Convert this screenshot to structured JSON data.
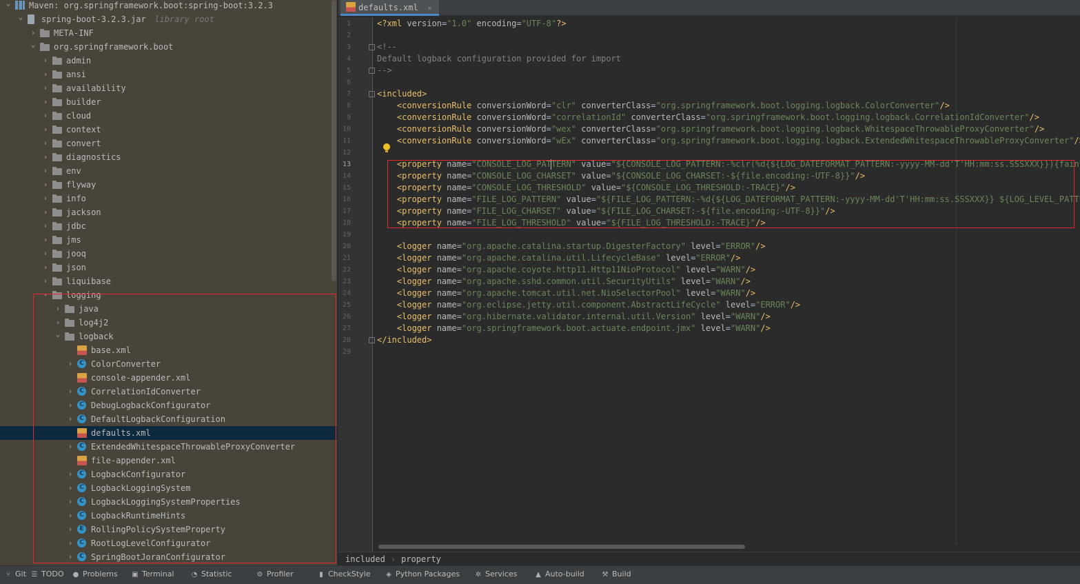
{
  "tree": {
    "items": [
      {
        "label": "Maven: org.springframework.boot:spring-boot:3.2.3",
        "icon": "maven-library-icon",
        "depth": 0,
        "chevron": "down"
      },
      {
        "label": "spring-boot-3.2.3.jar",
        "note": "library root",
        "icon": "jar-icon",
        "depth": 1,
        "chevron": "down"
      },
      {
        "label": "META-INF",
        "icon": "folder-icon",
        "depth": 2,
        "chevron": "right"
      },
      {
        "label": "org.springframework.boot",
        "icon": "folder-icon",
        "depth": 2,
        "chevron": "down"
      },
      {
        "label": "admin",
        "icon": "folder-icon",
        "depth": 3,
        "chevron": "right"
      },
      {
        "label": "ansi",
        "icon": "folder-icon",
        "depth": 3,
        "chevron": "right"
      },
      {
        "label": "availability",
        "icon": "folder-icon",
        "depth": 3,
        "chevron": "right"
      },
      {
        "label": "builder",
        "icon": "folder-icon",
        "depth": 3,
        "chevron": "right"
      },
      {
        "label": "cloud",
        "icon": "folder-icon",
        "depth": 3,
        "chevron": "right"
      },
      {
        "label": "context",
        "icon": "folder-icon",
        "depth": 3,
        "chevron": "right"
      },
      {
        "label": "convert",
        "icon": "folder-icon",
        "depth": 3,
        "chevron": "right"
      },
      {
        "label": "diagnostics",
        "icon": "folder-icon",
        "depth": 3,
        "chevron": "right"
      },
      {
        "label": "env",
        "icon": "folder-icon",
        "depth": 3,
        "chevron": "right"
      },
      {
        "label": "flyway",
        "icon": "folder-icon",
        "depth": 3,
        "chevron": "right"
      },
      {
        "label": "info",
        "icon": "folder-icon",
        "depth": 3,
        "chevron": "right"
      },
      {
        "label": "jackson",
        "icon": "folder-icon",
        "depth": 3,
        "chevron": "right"
      },
      {
        "label": "jdbc",
        "icon": "folder-icon",
        "depth": 3,
        "chevron": "right"
      },
      {
        "label": "jms",
        "icon": "folder-icon",
        "depth": 3,
        "chevron": "right"
      },
      {
        "label": "jooq",
        "icon": "folder-icon",
        "depth": 3,
        "chevron": "right"
      },
      {
        "label": "json",
        "icon": "folder-icon",
        "depth": 3,
        "chevron": "right"
      },
      {
        "label": "liquibase",
        "icon": "folder-icon",
        "depth": 3,
        "chevron": "right"
      },
      {
        "label": "logging",
        "icon": "folder-icon",
        "depth": 3,
        "chevron": "down"
      },
      {
        "label": "java",
        "icon": "folder-icon",
        "depth": 4,
        "chevron": "right"
      },
      {
        "label": "log4j2",
        "icon": "folder-icon",
        "depth": 4,
        "chevron": "right"
      },
      {
        "label": "logback",
        "icon": "folder-icon",
        "depth": 4,
        "chevron": "down"
      },
      {
        "label": "base.xml",
        "icon": "xml-file-icon",
        "depth": 5,
        "chevron": ""
      },
      {
        "label": "ColorConverter",
        "icon": "class-icon",
        "depth": 5,
        "chevron": "right"
      },
      {
        "label": "console-appender.xml",
        "icon": "xml-file-icon",
        "depth": 5,
        "chevron": ""
      },
      {
        "label": "CorrelationIdConverter",
        "icon": "class-icon",
        "depth": 5,
        "chevron": "right"
      },
      {
        "label": "DebugLogbackConfigurator",
        "icon": "class-icon",
        "depth": 5,
        "chevron": "right"
      },
      {
        "label": "DefaultLogbackConfiguration",
        "icon": "class-icon",
        "depth": 5,
        "chevron": "right"
      },
      {
        "label": "defaults.xml",
        "icon": "xml-file-icon",
        "depth": 5,
        "chevron": "",
        "selected": true
      },
      {
        "label": "ExtendedWhitespaceThrowableProxyConverter",
        "icon": "class-icon",
        "depth": 5,
        "chevron": "right"
      },
      {
        "label": "file-appender.xml",
        "icon": "xml-file-icon",
        "depth": 5,
        "chevron": ""
      },
      {
        "label": "LogbackConfigurator",
        "icon": "class-icon",
        "depth": 5,
        "chevron": "right"
      },
      {
        "label": "LogbackLoggingSystem",
        "icon": "class-icon",
        "depth": 5,
        "chevron": "right"
      },
      {
        "label": "LogbackLoggingSystemProperties",
        "icon": "class-icon",
        "depth": 5,
        "chevron": "right"
      },
      {
        "label": "LogbackRuntimeHints",
        "icon": "class-icon",
        "depth": 5,
        "chevron": "right"
      },
      {
        "label": "RollingPolicySystemProperty",
        "icon": "enum-icon",
        "depth": 5,
        "chevron": "right"
      },
      {
        "label": "RootLogLevelConfigurator",
        "icon": "class-icon",
        "depth": 5,
        "chevron": "right"
      },
      {
        "label": "SpringBootJoranConfigurator",
        "icon": "class-icon",
        "depth": 5,
        "chevron": "right"
      }
    ]
  },
  "editor": {
    "tab": {
      "label": "defaults.xml",
      "close": "×"
    },
    "current_line": 13,
    "lines": [
      [
        [
          "pi",
          "<?xml "
        ],
        [
          "attr",
          "version"
        ],
        [
          "",
          "="
        ],
        [
          "val",
          "\"1.0\""
        ],
        [
          "",
          " "
        ],
        [
          "attr",
          "encoding"
        ],
        [
          "",
          "="
        ],
        [
          "val",
          "\"UTF-8\""
        ],
        [
          "pi",
          "?>"
        ]
      ],
      [],
      [
        [
          "cmt",
          "<!--"
        ]
      ],
      [
        [
          "cmt",
          "Default logback configuration provided for import"
        ]
      ],
      [
        [
          "cmt",
          "-->"
        ]
      ],
      [],
      [
        [
          "tag",
          "<included>"
        ]
      ],
      [
        [
          "",
          "    "
        ],
        [
          "tag",
          "<conversionRule "
        ],
        [
          "attr",
          "conversionWord"
        ],
        [
          "",
          "="
        ],
        [
          "val",
          "\"clr\""
        ],
        [
          "",
          " "
        ],
        [
          "attr",
          "converterClass"
        ],
        [
          "",
          "="
        ],
        [
          "val",
          "\"org.springframework.boot.logging.logback.ColorConverter\""
        ],
        [
          "tag",
          "/>"
        ]
      ],
      [
        [
          "",
          "    "
        ],
        [
          "tag",
          "<conversionRule "
        ],
        [
          "attr",
          "conversionWord"
        ],
        [
          "",
          "="
        ],
        [
          "val",
          "\"correlationId\""
        ],
        [
          "",
          " "
        ],
        [
          "attr",
          "converterClass"
        ],
        [
          "",
          "="
        ],
        [
          "val",
          "\"org.springframework.boot.logging.logback.CorrelationIdConverter\""
        ],
        [
          "tag",
          "/>"
        ]
      ],
      [
        [
          "",
          "    "
        ],
        [
          "tag",
          "<conversionRule "
        ],
        [
          "attr",
          "conversionWord"
        ],
        [
          "",
          "="
        ],
        [
          "val",
          "\"wex\""
        ],
        [
          "",
          " "
        ],
        [
          "attr",
          "converterClass"
        ],
        [
          "",
          "="
        ],
        [
          "val",
          "\"org.springframework.boot.logging.logback.WhitespaceThrowableProxyConverter\""
        ],
        [
          "tag",
          "/>"
        ]
      ],
      [
        [
          "",
          "    "
        ],
        [
          "tag",
          "<conversionRule "
        ],
        [
          "attr",
          "conversionWord"
        ],
        [
          "",
          "="
        ],
        [
          "val",
          "\"wEx\""
        ],
        [
          "",
          " "
        ],
        [
          "attr",
          "converterClass"
        ],
        [
          "",
          "="
        ],
        [
          "val",
          "\"org.springframework.boot.logging.logback.ExtendedWhitespaceThrowableProxyConverter\""
        ],
        [
          "tag",
          "/>"
        ]
      ],
      [],
      [
        [
          "",
          "    "
        ],
        [
          "tag",
          "<property "
        ],
        [
          "attr",
          "name"
        ],
        [
          "",
          "="
        ],
        [
          "val",
          "\"CONSOLE_LOG_PATTERN\""
        ],
        [
          "",
          " "
        ],
        [
          "attr",
          "value"
        ],
        [
          "",
          "="
        ],
        [
          "val",
          "\"${CONSOLE_LOG_PATTERN:-%clr(%d{${LOG_DATEFORMAT_PATTERN:-yyyy-MM-dd'T'HH:mm:ss.SSSXXX}}){faint} %c"
        ]
      ],
      [
        [
          "",
          "    "
        ],
        [
          "tag",
          "<property "
        ],
        [
          "attr",
          "name"
        ],
        [
          "",
          "="
        ],
        [
          "val",
          "\"CONSOLE_LOG_CHARSET\""
        ],
        [
          "",
          " "
        ],
        [
          "attr",
          "value"
        ],
        [
          "",
          "="
        ],
        [
          "val",
          "\"${CONSOLE_LOG_CHARSET:-${file.encoding:-UTF-8}}\""
        ],
        [
          "tag",
          "/>"
        ]
      ],
      [
        [
          "",
          "    "
        ],
        [
          "tag",
          "<property "
        ],
        [
          "attr",
          "name"
        ],
        [
          "",
          "="
        ],
        [
          "val",
          "\"CONSOLE_LOG_THRESHOLD\""
        ],
        [
          "",
          " "
        ],
        [
          "attr",
          "value"
        ],
        [
          "",
          "="
        ],
        [
          "val",
          "\"${CONSOLE_LOG_THRESHOLD:-TRACE}\""
        ],
        [
          "tag",
          "/>"
        ]
      ],
      [
        [
          "",
          "    "
        ],
        [
          "tag",
          "<property "
        ],
        [
          "attr",
          "name"
        ],
        [
          "",
          "="
        ],
        [
          "val",
          "\"FILE_LOG_PATTERN\""
        ],
        [
          "",
          " "
        ],
        [
          "attr",
          "value"
        ],
        [
          "",
          "="
        ],
        [
          "val",
          "\"${FILE_LOG_PATTERN:-%d{${LOG_DATEFORMAT_PATTERN:-yyyy-MM-dd'T'HH:mm:ss.SSSXXX}} ${LOG_LEVEL_PATTERN -"
        ]
      ],
      [
        [
          "",
          "    "
        ],
        [
          "tag",
          "<property "
        ],
        [
          "attr",
          "name"
        ],
        [
          "",
          "="
        ],
        [
          "val",
          "\"FILE_LOG_CHARSET\""
        ],
        [
          "",
          " "
        ],
        [
          "attr",
          "value"
        ],
        [
          "",
          "="
        ],
        [
          "val",
          "\"${FILE_LOG_CHARSET:-${file.encoding:-UTF-8}}\""
        ],
        [
          "tag",
          "/>"
        ]
      ],
      [
        [
          "",
          "    "
        ],
        [
          "tag",
          "<property "
        ],
        [
          "attr",
          "name"
        ],
        [
          "",
          "="
        ],
        [
          "val",
          "\"FILE_LOG_THRESHOLD\""
        ],
        [
          "",
          " "
        ],
        [
          "attr",
          "value"
        ],
        [
          "",
          "="
        ],
        [
          "val",
          "\"${FILE_LOG_THRESHOLD:-TRACE}\""
        ],
        [
          "tag",
          "/>"
        ]
      ],
      [],
      [
        [
          "",
          "    "
        ],
        [
          "tag",
          "<logger "
        ],
        [
          "attr",
          "name"
        ],
        [
          "",
          "="
        ],
        [
          "val",
          "\"org.apache.catalina.startup.DigesterFactory\""
        ],
        [
          "",
          " "
        ],
        [
          "attr",
          "level"
        ],
        [
          "",
          "="
        ],
        [
          "val",
          "\"ERROR\""
        ],
        [
          "tag",
          "/>"
        ]
      ],
      [
        [
          "",
          "    "
        ],
        [
          "tag",
          "<logger "
        ],
        [
          "attr",
          "name"
        ],
        [
          "",
          "="
        ],
        [
          "val",
          "\"org.apache.catalina.util.LifecycleBase\""
        ],
        [
          "",
          " "
        ],
        [
          "attr",
          "level"
        ],
        [
          "",
          "="
        ],
        [
          "val",
          "\"ERROR\""
        ],
        [
          "tag",
          "/>"
        ]
      ],
      [
        [
          "",
          "    "
        ],
        [
          "tag",
          "<logger "
        ],
        [
          "attr",
          "name"
        ],
        [
          "",
          "="
        ],
        [
          "val",
          "\"org.apache.coyote.http11.Http11NioProtocol\""
        ],
        [
          "",
          " "
        ],
        [
          "attr",
          "level"
        ],
        [
          "",
          "="
        ],
        [
          "val",
          "\"WARN\""
        ],
        [
          "tag",
          "/>"
        ]
      ],
      [
        [
          "",
          "    "
        ],
        [
          "tag",
          "<logger "
        ],
        [
          "attr",
          "name"
        ],
        [
          "",
          "="
        ],
        [
          "val",
          "\"org.apache.sshd.common.util.SecurityUtils\""
        ],
        [
          "",
          " "
        ],
        [
          "attr",
          "level"
        ],
        [
          "",
          "="
        ],
        [
          "val",
          "\"WARN\""
        ],
        [
          "tag",
          "/>"
        ]
      ],
      [
        [
          "",
          "    "
        ],
        [
          "tag",
          "<logger "
        ],
        [
          "attr",
          "name"
        ],
        [
          "",
          "="
        ],
        [
          "val",
          "\"org.apache.tomcat.util.net.NioSelectorPool\""
        ],
        [
          "",
          " "
        ],
        [
          "attr",
          "level"
        ],
        [
          "",
          "="
        ],
        [
          "val",
          "\"WARN\""
        ],
        [
          "tag",
          "/>"
        ]
      ],
      [
        [
          "",
          "    "
        ],
        [
          "tag",
          "<logger "
        ],
        [
          "attr",
          "name"
        ],
        [
          "",
          "="
        ],
        [
          "val",
          "\"org.eclipse.jetty.util.component.AbstractLifeCycle\""
        ],
        [
          "",
          " "
        ],
        [
          "attr",
          "level"
        ],
        [
          "",
          "="
        ],
        [
          "val",
          "\"ERROR\""
        ],
        [
          "tag",
          "/>"
        ]
      ],
      [
        [
          "",
          "    "
        ],
        [
          "tag",
          "<logger "
        ],
        [
          "attr",
          "name"
        ],
        [
          "",
          "="
        ],
        [
          "val",
          "\"org.hibernate.validator.internal.util.Version\""
        ],
        [
          "",
          " "
        ],
        [
          "attr",
          "level"
        ],
        [
          "",
          "="
        ],
        [
          "val",
          "\"WARN\""
        ],
        [
          "tag",
          "/>"
        ]
      ],
      [
        [
          "",
          "    "
        ],
        [
          "tag",
          "<logger "
        ],
        [
          "attr",
          "name"
        ],
        [
          "",
          "="
        ],
        [
          "val",
          "\"org.springframework.boot.actuate.endpoint.jmx\""
        ],
        [
          "",
          " "
        ],
        [
          "attr",
          "level"
        ],
        [
          "",
          "="
        ],
        [
          "val",
          "\"WARN\""
        ],
        [
          "tag",
          "/>"
        ]
      ],
      [
        [
          "tag",
          "</included>"
        ]
      ],
      []
    ]
  },
  "breadcrumb": {
    "items": [
      "included",
      "property"
    ],
    "separator": "›"
  },
  "toolbar": {
    "items": [
      {
        "label": "Git",
        "icon": "git-branch-icon"
      },
      {
        "label": "TODO",
        "icon": "todo-list-icon"
      },
      {
        "label": "Problems",
        "icon": "problems-icon"
      },
      {
        "label": "Terminal",
        "icon": "terminal-icon"
      },
      {
        "label": "Statistic",
        "icon": "statistic-icon"
      },
      {
        "label": "Profiler",
        "icon": "profiler-icon"
      },
      {
        "label": "CheckStyle",
        "icon": "checkstyle-icon"
      },
      {
        "label": "Python Packages",
        "icon": "python-packages-icon"
      },
      {
        "label": "Services",
        "icon": "services-icon"
      },
      {
        "label": "Auto-build",
        "icon": "auto-build-icon"
      },
      {
        "label": "Build",
        "icon": "build-hammer-icon"
      }
    ]
  },
  "colors": {
    "tree_bg": "#48443a",
    "editor_bg": "#2b2b2b",
    "selection": "#0d293e",
    "highlight_box": "#e0282e",
    "xml_tag": "#e8bf6a",
    "xml_value": "#6a8759",
    "comment": "#808080"
  }
}
